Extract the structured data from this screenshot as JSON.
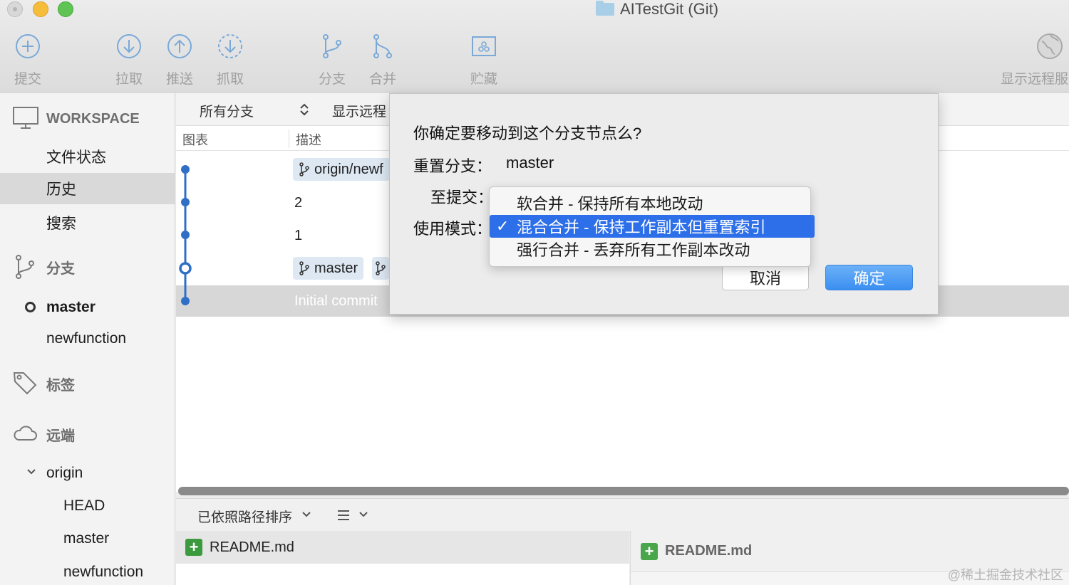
{
  "window": {
    "title": "AITestGit (Git)"
  },
  "toolbar": {
    "commit": "提交",
    "pull": "拉取",
    "push": "推送",
    "fetch": "抓取",
    "branch": "分支",
    "merge": "合并",
    "stash": "贮藏",
    "show_remote": "显示远程服"
  },
  "sidebar": {
    "workspace": "WORKSPACE",
    "file_status": "文件状态",
    "history": "历史",
    "search": "搜索",
    "branches": "分支",
    "branch_items": [
      "master",
      "newfunction"
    ],
    "tags": "标签",
    "remotes": "远端",
    "remote_origin": "origin",
    "remote_items": [
      "HEAD",
      "master",
      "newfunction"
    ]
  },
  "history": {
    "filter_all": "所有分支",
    "filter_remote": "显示远程",
    "col_graph": "图表",
    "col_desc": "描述",
    "rows": [
      {
        "tag": "origin/newf",
        "text": ""
      },
      {
        "tag": "",
        "text": "2"
      },
      {
        "tag": "",
        "text": "1"
      },
      {
        "tag": "master",
        "text": ""
      },
      {
        "tag": "",
        "text": "Initial commit"
      }
    ]
  },
  "bottom": {
    "sort_label": "已依照路径排序",
    "file": "README.md",
    "diff_file": "README.md"
  },
  "dialog": {
    "question": "你确定要移动到这个分支节点么?",
    "reset_branch_label": "重置分支：",
    "reset_branch_value": "master",
    "to_commit_label": "至提交：",
    "mode_label": "使用模式：",
    "cancel": "取消",
    "ok": "确定"
  },
  "mode_menu": {
    "options": [
      "软合并 - 保持所有本地改动",
      "混合合并 - 保持工作副本但重置索引",
      "强行合并 - 丢弃所有工作副本改动"
    ],
    "selected": "混合合并 - 保持工作副本但重置索引"
  },
  "watermark": "@稀土掘金技术社区",
  "colors": {
    "accent": "#2d6fe8",
    "graph_line": "#2f6fc6",
    "add_green": "#3b9a3e"
  }
}
